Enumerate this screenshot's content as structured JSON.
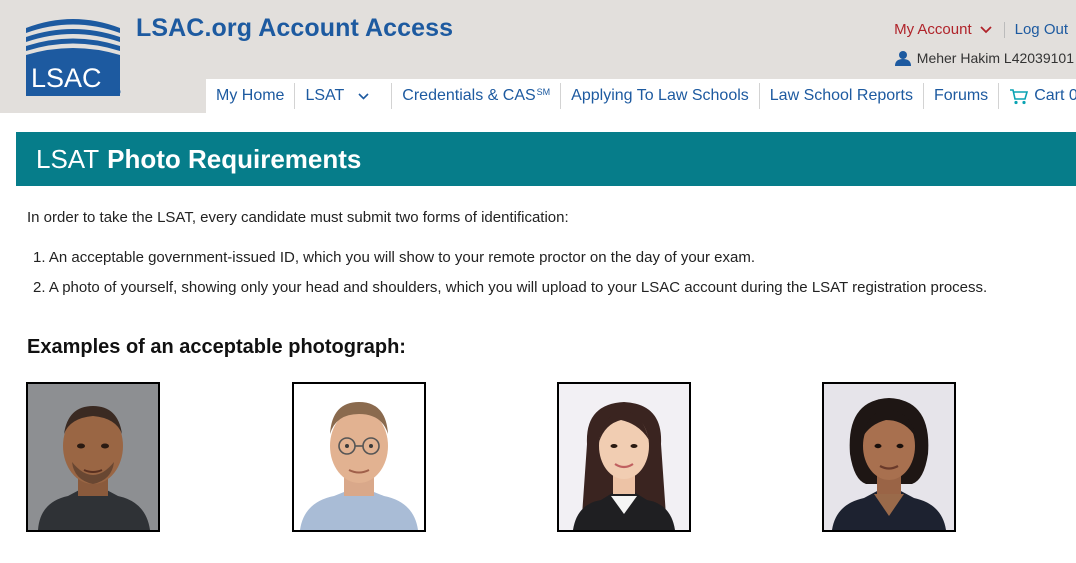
{
  "header": {
    "logo_text": "LSAC",
    "logo_mark": "®",
    "site_title": "LSAC.org Account Access",
    "my_account": "My Account",
    "log_out": "Log Out",
    "user_name": "Meher Hakim L42039101"
  },
  "nav": {
    "items": [
      {
        "label": "My Home"
      },
      {
        "label": "LSAT"
      },
      {
        "label": "Credentials & CAS",
        "sup": "SM"
      },
      {
        "label": "Applying To Law Schools"
      },
      {
        "label": "Law School Reports"
      },
      {
        "label": "Forums"
      },
      {
        "label": "Cart 0"
      }
    ]
  },
  "banner": {
    "title_light": "LSAT",
    "title_bold": "Photo Requirements"
  },
  "content": {
    "intro": "In order to take the LSAT, every candidate must submit two forms of identification:",
    "list": [
      "1. An acceptable government-issued ID, which you will show to your remote proctor on the day of your exam.",
      "2. A photo of yourself, showing only your head and shoulders, which you will upload to your LSAC account during the LSAT registration process."
    ],
    "examples_heading": "Examples of an acceptable photograph:"
  },
  "colors": {
    "brand_blue": "#1d5aa0",
    "account_red": "#b0232a",
    "banner_teal": "#067d8a",
    "topbar_bg": "#e2dfdc"
  },
  "icons": [
    "lsac-logo",
    "chevron-down-icon",
    "user-icon",
    "cart-icon"
  ]
}
